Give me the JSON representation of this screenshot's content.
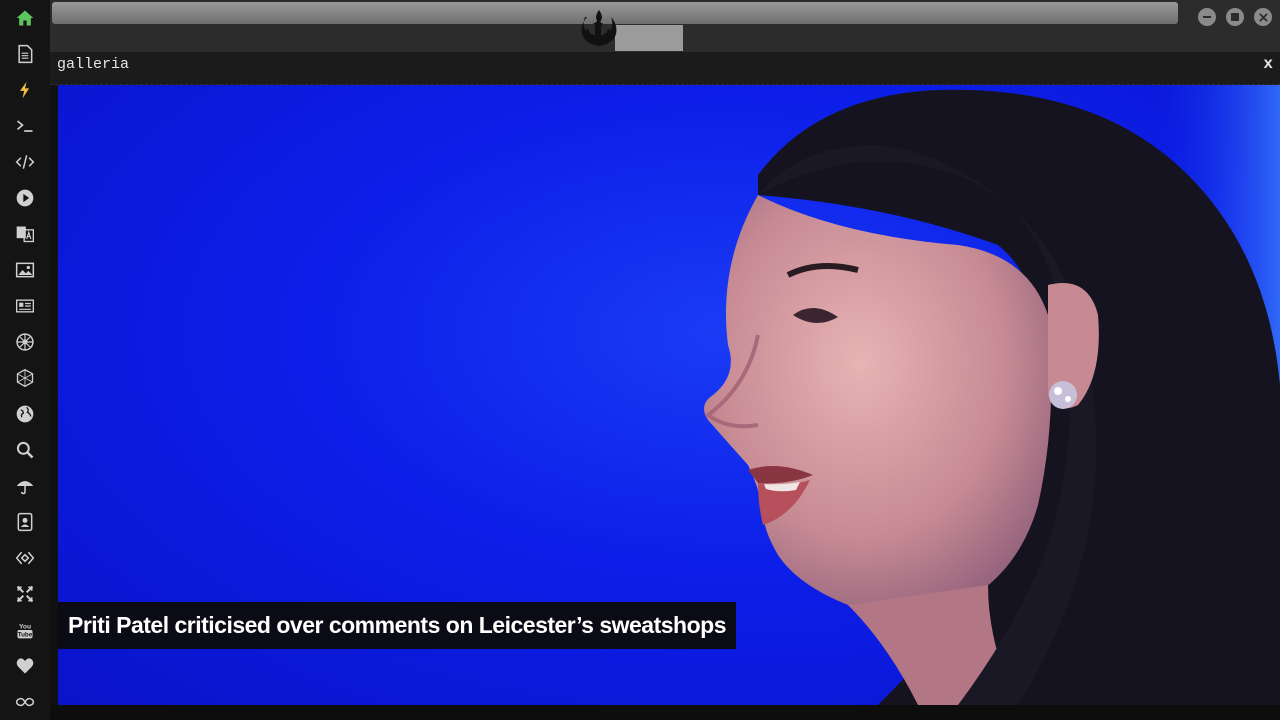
{
  "sidebar": {
    "items": [
      {
        "icon": "home-icon",
        "color": "#5cc65c"
      },
      {
        "icon": "document-icon",
        "color": "#d0d0d0"
      },
      {
        "icon": "lightning-icon",
        "color": "#f0c040"
      },
      {
        "icon": "terminal-icon",
        "color": "#d0d0d0"
      },
      {
        "icon": "code-icon",
        "color": "#d0d0d0"
      },
      {
        "icon": "play-icon",
        "color": "#d0d0d0"
      },
      {
        "icon": "translate-icon",
        "color": "#d0d0d0"
      },
      {
        "icon": "image-icon",
        "color": "#d0d0d0"
      },
      {
        "icon": "newspaper-icon",
        "color": "#d0d0d0"
      },
      {
        "icon": "empire-icon",
        "color": "#d0d0d0"
      },
      {
        "icon": "hexagon-icon",
        "color": "#d0d0d0"
      },
      {
        "icon": "globe-icon",
        "color": "#d0d0d0"
      },
      {
        "icon": "search-icon",
        "color": "#d0d0d0"
      },
      {
        "icon": "umbrella-icon",
        "color": "#d0d0d0"
      },
      {
        "icon": "contacts-icon",
        "color": "#d0d0d0"
      },
      {
        "icon": "diamond-code-icon",
        "color": "#d0d0d0"
      },
      {
        "icon": "expand-icon",
        "color": "#d0d0d0"
      },
      {
        "icon": "youtube-icon",
        "color": "#d0d0d0"
      },
      {
        "icon": "heart-icon",
        "color": "#d0d0d0"
      },
      {
        "icon": "infinity-icon",
        "color": "#d0d0d0"
      }
    ]
  },
  "window": {
    "emblem_icon": "rebel-alliance-icon",
    "controls": [
      "minimize-icon",
      "maximize-icon",
      "close-icon"
    ]
  },
  "panel": {
    "title": "galleria",
    "close_label": "x"
  },
  "gallery": {
    "caption": "Priti Patel criticised over comments on Leicester’s sweatshops",
    "background_color": "#0c1ee8"
  }
}
